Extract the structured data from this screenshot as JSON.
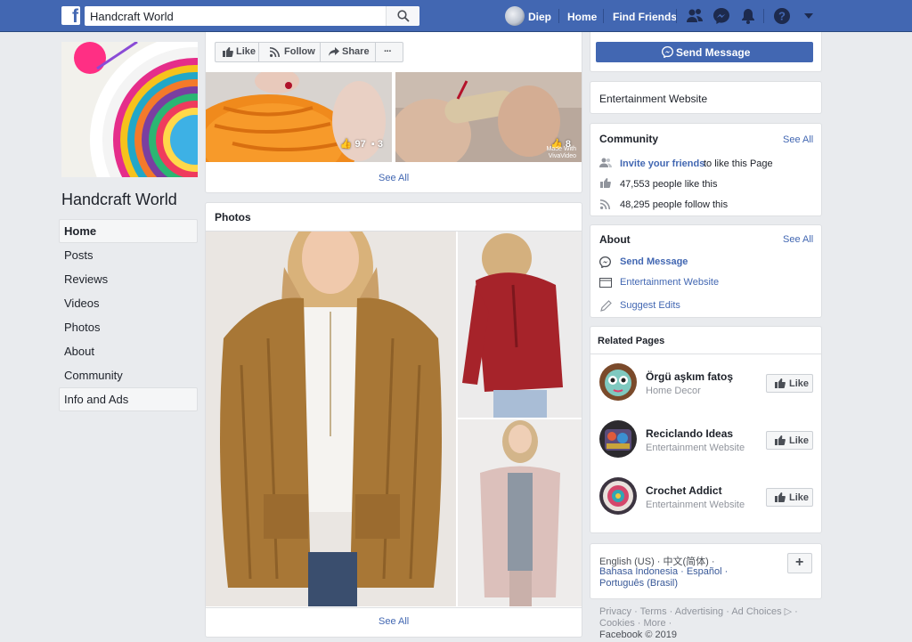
{
  "header": {
    "search_value": "Handcraft World",
    "user_name": "Diep",
    "nav_home": "Home",
    "nav_find_friends": "Find Friends"
  },
  "page": {
    "title": "Handcraft World",
    "nav_items": [
      "Home",
      "Posts",
      "Reviews",
      "Videos",
      "Photos",
      "About",
      "Community",
      "Info and Ads"
    ]
  },
  "actions": {
    "like": "Like",
    "follow": "Follow",
    "share": "Share",
    "more": "···"
  },
  "videos": {
    "thumb1": {
      "likes": "97",
      "comments": "3"
    },
    "thumb2": {
      "likes": "8",
      "watermark": "Made With VivaVideo"
    },
    "see_all": "See All"
  },
  "photos": {
    "title": "Photos",
    "see_all": "See All"
  },
  "right": {
    "send_message": "Send Message",
    "category": "Entertainment Website",
    "community": {
      "title": "Community",
      "see_all": "See All",
      "invite_link": "Invite your friends",
      "invite_rest": " to like this Page",
      "likes": "47,553 people like this",
      "follows": "48,295 people follow this"
    },
    "about": {
      "title": "About",
      "see_all": "See All",
      "send_message": "Send Message",
      "category": "Entertainment Website",
      "suggest_edits": "Suggest Edits"
    },
    "related": {
      "title": "Related Pages",
      "like_label": "Like",
      "pages": [
        {
          "name": "Örgü aşkım fatoş",
          "category": "Home Decor"
        },
        {
          "name": "Reciclando Ideas",
          "category": "Entertainment Website"
        },
        {
          "name": "Crochet Addict",
          "category": "Entertainment Website"
        }
      ]
    },
    "languages": {
      "line1": "English (US) · 中文(简体) ·",
      "line2": "Bahasa Indonesia · Español ·",
      "line3": "Português (Brasil)"
    },
    "footer": {
      "line1": "Privacy · Terms · Advertising · Ad Choices ▷ ·",
      "line2": "Cookies · More ·",
      "line3": "Facebook © 2019"
    }
  },
  "colors": {
    "brand_blue": "#4267b2",
    "link_blue": "#385898",
    "background": "#e9ebee"
  }
}
